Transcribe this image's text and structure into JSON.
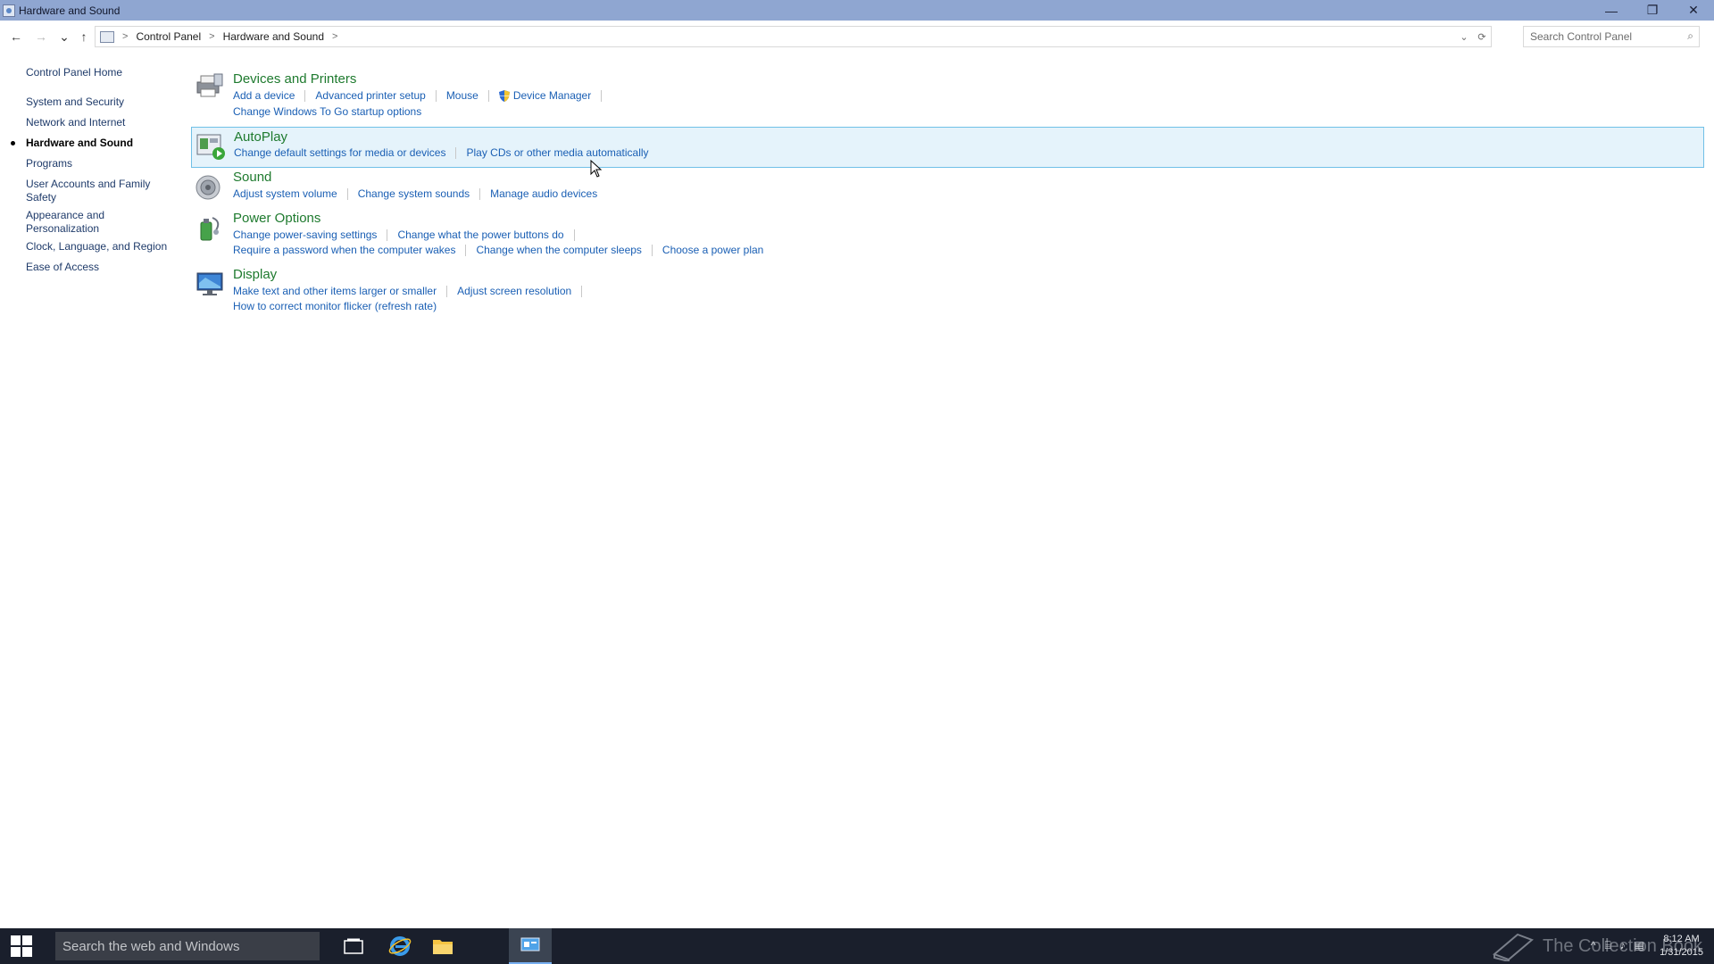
{
  "window": {
    "title": "Hardware and Sound",
    "controls": {
      "minimize": "—",
      "restore": "❐",
      "close": "✕"
    }
  },
  "addressbar": {
    "back": "←",
    "forward": "→",
    "recent": "⌄",
    "up": "↑",
    "breadcrumbs": [
      "Control Panel",
      "Hardware and Sound"
    ],
    "search_placeholder": "Search Control Panel"
  },
  "leftnav": {
    "home": "Control Panel Home",
    "items": [
      {
        "label": "System and Security"
      },
      {
        "label": "Network and Internet"
      },
      {
        "label": "Hardware and Sound",
        "current": true
      },
      {
        "label": "Programs"
      },
      {
        "label": "User Accounts and Family Safety"
      },
      {
        "label": "Appearance and Personalization"
      },
      {
        "label": "Clock, Language, and Region"
      },
      {
        "label": "Ease of Access"
      }
    ]
  },
  "categories": [
    {
      "title": "Devices and Printers",
      "rows": [
        [
          "Add a device",
          "Advanced printer setup",
          "Mouse",
          "Device Manager"
        ],
        [
          "Change Windows To Go startup options"
        ]
      ]
    },
    {
      "title": "AutoPlay",
      "rows": [
        [
          "Change default settings for media or devices",
          "Play CDs or other media automatically"
        ]
      ]
    },
    {
      "title": "Sound",
      "rows": [
        [
          "Adjust system volume",
          "Change system sounds",
          "Manage audio devices"
        ]
      ]
    },
    {
      "title": "Power Options",
      "rows": [
        [
          "Change power-saving settings",
          "Change what the power buttons do"
        ],
        [
          "Require a password when the computer wakes",
          "Change when the computer sleeps",
          "Choose a power plan"
        ]
      ]
    },
    {
      "title": "Display",
      "rows": [
        [
          "Make text and other items larger or smaller",
          "Adjust screen resolution"
        ],
        [
          "How to correct monitor flicker (refresh rate)"
        ]
      ]
    }
  ],
  "taskbar": {
    "search_placeholder": "Search the web and Windows",
    "watermark": "The Collection Book",
    "clock_time": "8:12 AM",
    "clock_date": "1/31/2015"
  },
  "colors": {
    "titlebar": "#8fa6d1",
    "category_title": "#1e7a2e",
    "link": "#1a5fb4",
    "highlight_bg": "#e5f3fb",
    "highlight_border": "#70c0e7",
    "taskbar": "#1a1f2c"
  }
}
